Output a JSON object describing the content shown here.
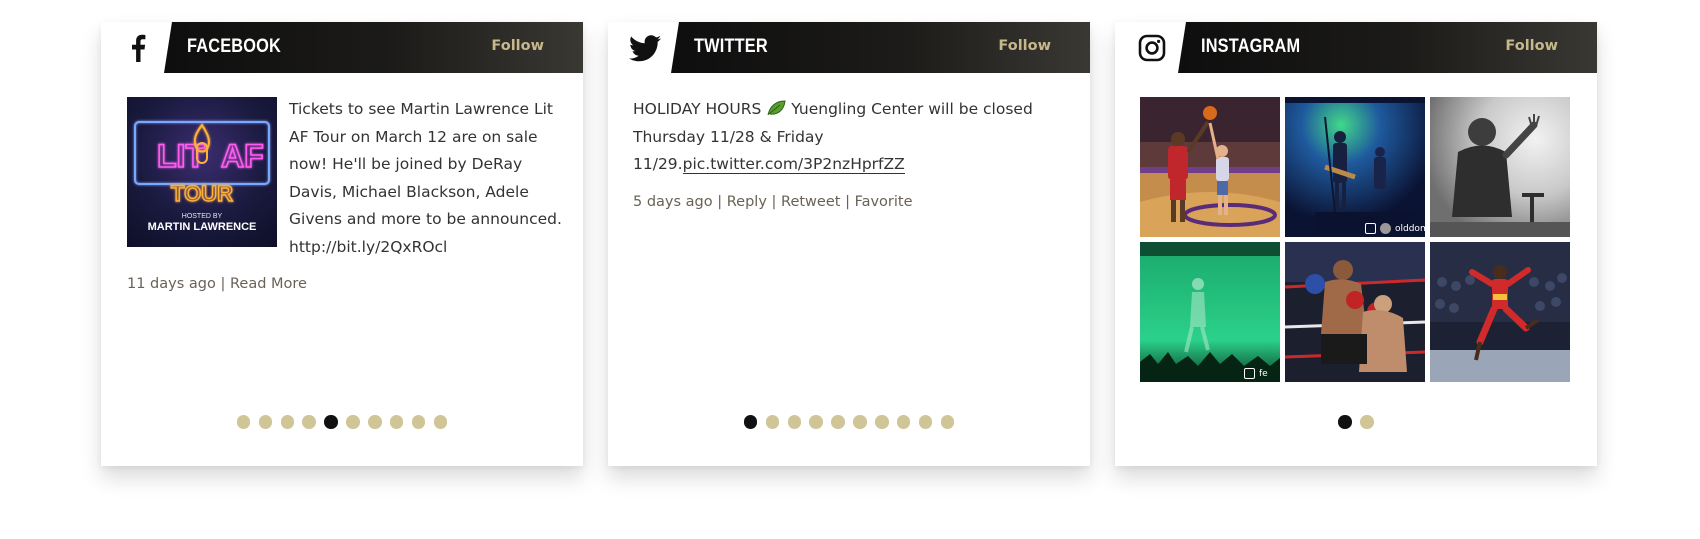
{
  "facebook": {
    "title": "FACEBOOK",
    "follow": "Follow",
    "icon": "facebook-icon",
    "post": {
      "image_text": {
        "line1": "LIT",
        "line2": "AF",
        "line3": "TOUR",
        "hosted_by": "HOSTED BY",
        "host": "MARTIN LAWRENCE"
      },
      "text": "Tickets to see Martin Lawrence Lit AF Tour on March 12 are on sale now! He'll be joined by DeRay Davis, Michael Blackson, Adele Givens and more to be announced. http://bit.ly/2QxROcl",
      "time": "11 days ago",
      "separator": "|",
      "read_more": "Read More"
    },
    "dots_total": 10,
    "dot_active": 5
  },
  "twitter": {
    "title": "TWITTER",
    "follow": "Follow",
    "icon": "twitter-bird-icon",
    "tweet": {
      "text_before": "HOLIDAY HOURS ",
      "emoji_name": "leaf-icon",
      "text_after": " Yuengling Center will be closed Thursday 11/28 & Friday 11/29.",
      "link": "pic.twitter.com/3P2nzHprfZZ",
      "time": "5 days ago",
      "separator": "|",
      "reply": "Reply",
      "retweet": "Retweet",
      "favorite": "Favorite"
    },
    "dots_total": 10,
    "dot_active": 1
  },
  "instagram": {
    "title": "INSTAGRAM",
    "follow": "Follow",
    "icon": "instagram-icon",
    "photos": [
      {
        "name": "basketball-handshake-photo",
        "overlay": ""
      },
      {
        "name": "concert-band-photo",
        "overlay": "olddom"
      },
      {
        "name": "performer-silhouette-photo",
        "overlay": ""
      },
      {
        "name": "green-stage-photo",
        "overlay": "fe"
      },
      {
        "name": "boxing-match-photo",
        "overlay": ""
      },
      {
        "name": "basketball-player-jump-photo",
        "overlay": ""
      }
    ],
    "dots_total": 2,
    "dot_active": 1
  },
  "colors": {
    "header_dark": "#111111",
    "follow_gold": "#c6b88a",
    "dot_inactive": "#d0c596",
    "dot_active": "#111111",
    "meta_text": "#6a6256"
  }
}
